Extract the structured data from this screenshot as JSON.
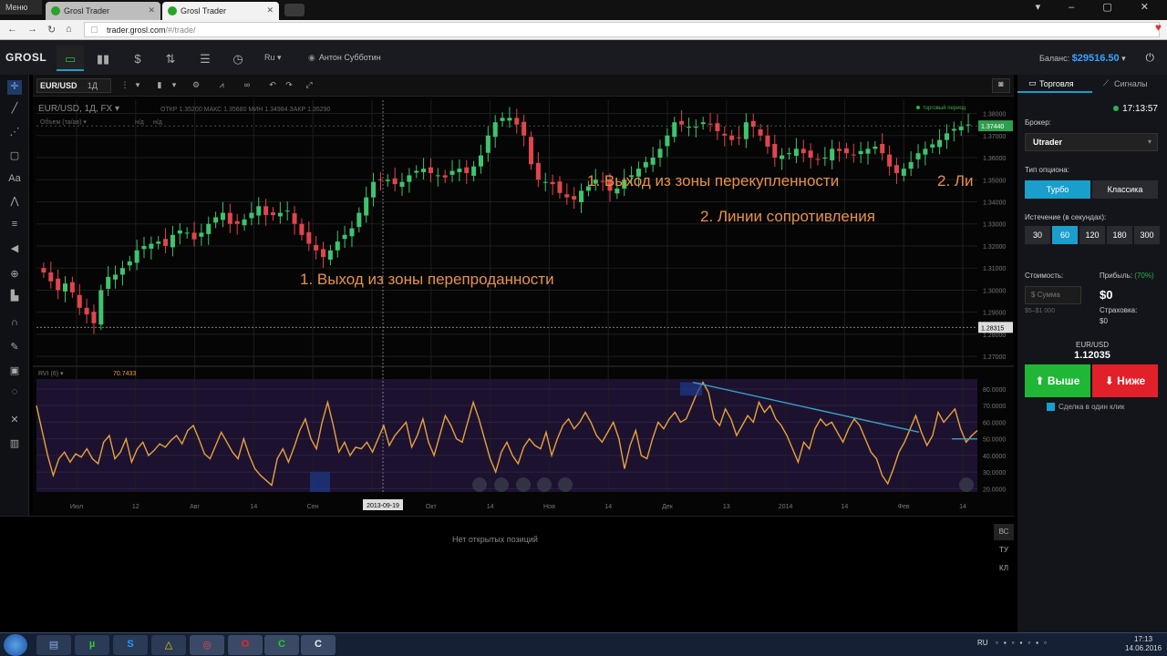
{
  "browser": {
    "menu_label": "Меню",
    "tabs": [
      {
        "title": "Grosl Trader",
        "active": false
      },
      {
        "title": "Grosl Trader",
        "active": true
      }
    ],
    "url_host": "trader.grosl.com",
    "url_path": "/#/trade/"
  },
  "header": {
    "logo": "GROSL",
    "lang": "Ru ▾",
    "username": "Антон Субботин",
    "balance_label": "Баланс:",
    "balance_value": "$29516.50"
  },
  "chart_toolbar": {
    "symbol": "EUR/USD",
    "timeframe": "1Д"
  },
  "chart_data": {
    "type": "candlestick",
    "info_line": "EUR/USD, 1Д, FX",
    "ohlc": {
      "open_label": "ОТКР",
      "open": "1.35200",
      "high_label": "МАКС",
      "high": "1.35680",
      "low_label": "МИН",
      "low": "1.34984",
      "close_label": "ЗАКР",
      "close": "1.35290"
    },
    "volume_label": "Объем (та/ав)",
    "na1": "н/д",
    "na2": "н/д",
    "session_label": "торговый период",
    "last_price": "1.37440",
    "crosshair_price": "1.28315",
    "crosshair_date": "2013-09-19",
    "y_ticks": [
      "1.38000",
      "1.37000",
      "1.36000",
      "1.35000",
      "1.34000",
      "1.33000",
      "1.32000",
      "1.31000",
      "1.30000",
      "1.29000",
      "1.28000",
      "1.27000"
    ],
    "ylim": [
      1.268,
      1.386
    ],
    "x_ticks": [
      "Июл",
      "12",
      "Авг",
      "14",
      "Сен",
      "16",
      "Окт",
      "14",
      "Ноя",
      "14",
      "Дек",
      "13",
      "2014",
      "14",
      "Фев",
      "14"
    ],
    "close_series": [
      1.308,
      1.304,
      1.3,
      1.303,
      1.299,
      1.292,
      1.289,
      1.285,
      1.3,
      1.306,
      1.307,
      1.31,
      1.313,
      1.318,
      1.32,
      1.321,
      1.322,
      1.32,
      1.325,
      1.327,
      1.326,
      1.323,
      1.326,
      1.33,
      1.333,
      1.335,
      1.33,
      1.33,
      1.332,
      1.335,
      1.338,
      1.334,
      1.334,
      1.335,
      1.336,
      1.33,
      1.325,
      1.321,
      1.318,
      1.315,
      1.318,
      1.322,
      1.325,
      1.328,
      1.335,
      1.342,
      1.349,
      1.35,
      1.35,
      1.348,
      1.349,
      1.352,
      1.354,
      1.355,
      1.353,
      1.352,
      1.351,
      1.354,
      1.355,
      1.353,
      1.356,
      1.361,
      1.37,
      1.376,
      1.378,
      1.378,
      1.375,
      1.37,
      1.357,
      1.35,
      1.349,
      1.348,
      1.344,
      1.342,
      1.341,
      1.345,
      1.347,
      1.35,
      1.349,
      1.345,
      1.346,
      1.35,
      1.352,
      1.355,
      1.358,
      1.36,
      1.364,
      1.37,
      1.376,
      1.375,
      1.374,
      1.374,
      1.376,
      1.375,
      1.372,
      1.37,
      1.368,
      1.369,
      1.376,
      1.374,
      1.37,
      1.365,
      1.36,
      1.361,
      1.362,
      1.364,
      1.362,
      1.36,
      1.359,
      1.36,
      1.364,
      1.363,
      1.362,
      1.361,
      1.363,
      1.364,
      1.365,
      1.362,
      1.356,
      1.353,
      1.355,
      1.358,
      1.362,
      1.364,
      1.366,
      1.368,
      1.371,
      1.373,
      1.374,
      1.375
    ],
    "annotations": [
      "1. Выход из зоны перепроданности",
      "1. Выход из зоны перекупленности",
      "2. Линии сопротивления",
      "2. Ли"
    ],
    "indicator": {
      "name": "RVI (6) ▾",
      "value": "70.7433",
      "y_ticks": [
        "80.0000",
        "70.0000",
        "60.0000",
        "50.0000",
        "40.0000",
        "30.0000",
        "20.0000"
      ],
      "ylim": [
        18,
        86
      ],
      "series": [
        70,
        55,
        40,
        28,
        38,
        42,
        36,
        41,
        39,
        44,
        38,
        35,
        48,
        52,
        38,
        42,
        50,
        36,
        44,
        48,
        40,
        43,
        47,
        45,
        49,
        52,
        47,
        55,
        58,
        50,
        41,
        38,
        46,
        54,
        48,
        42,
        38,
        50,
        40,
        32,
        28,
        25,
        22,
        38,
        44,
        36,
        45,
        55,
        62,
        50,
        44,
        60,
        72,
        58,
        42,
        48,
        40,
        45,
        44,
        48,
        42,
        50,
        58,
        46,
        52,
        56,
        60,
        45,
        52,
        62,
        48,
        40,
        52,
        64,
        58,
        50,
        48,
        60,
        72,
        62,
        50,
        38,
        30,
        42,
        48,
        40,
        35,
        45,
        50,
        46,
        44,
        54,
        40,
        50,
        58,
        62,
        56,
        60,
        66,
        60,
        52,
        48,
        54,
        60,
        50,
        32,
        46,
        55,
        40,
        38,
        50,
        60,
        56,
        62,
        66,
        60,
        62,
        70,
        78,
        84,
        78,
        62,
        58,
        68,
        62,
        52,
        58,
        64,
        60,
        72,
        66,
        70,
        62,
        58,
        52,
        44,
        36,
        48,
        44,
        56,
        62,
        58,
        60,
        54,
        48,
        56,
        62,
        58,
        50,
        42,
        38,
        28,
        23,
        32,
        42,
        48,
        56,
        64,
        54,
        46,
        52,
        66,
        60,
        64,
        68,
        56,
        48,
        52,
        55
      ],
      "x_ticks": [
        "Июл",
        "12",
        "Авг",
        "14",
        "Сен",
        "16",
        "Окт",
        "14",
        "Ноя",
        "14",
        "Дек",
        "13",
        "2014",
        "14",
        "Фев",
        "14"
      ]
    }
  },
  "bottom": {
    "no_positions": "Нет открытых позиций",
    "tabs": [
      "ВС",
      "ТУ",
      "КЛ"
    ]
  },
  "right": {
    "tab_trade": "Торговля",
    "tab_signals": "Сигналы",
    "time": "17:13:57",
    "broker_label": "Брокер:",
    "broker_value": "Utrader",
    "option_type_label": "Тип опциона:",
    "option_turbo": "Турбо",
    "option_classic": "Классика",
    "expiry_label": "Истечение (в секундах):",
    "expiry_options": [
      "30",
      "60",
      "120",
      "180",
      "300"
    ],
    "expiry_selected": "60",
    "cost_label": "Стоимость:",
    "amount_placeholder": "$ Сумма",
    "range_hint": "$5–$1 000",
    "profit_label": "Прибыль:",
    "profit_pct": "(70%)",
    "profit_value": "$0",
    "insurance_label": "Страховка:",
    "insurance_value": "$0",
    "pair": "EUR/USD",
    "price": "1.12035",
    "up_label": "⬆ Выше",
    "down_label": "⬇ Ниже",
    "one_click_label": "Сделка в один клик"
  },
  "taskbar": {
    "lang": "RU",
    "time": "17:13",
    "date": "14.06.2016"
  }
}
